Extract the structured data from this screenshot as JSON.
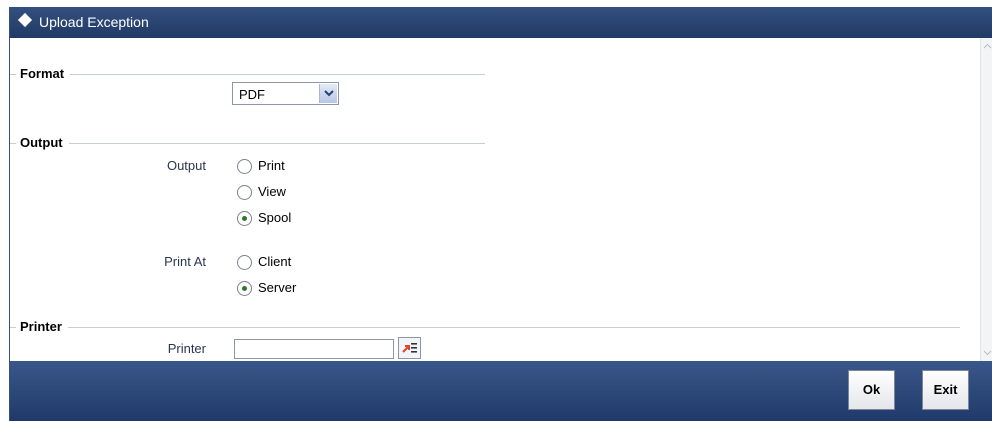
{
  "window": {
    "title": "Upload Exception"
  },
  "format": {
    "legend": "Format",
    "selected": "PDF"
  },
  "output": {
    "legend": "Output",
    "output_label": "Output",
    "output_options": [
      {
        "label": "Print",
        "checked": false
      },
      {
        "label": "View",
        "checked": false
      },
      {
        "label": "Spool",
        "checked": true
      }
    ],
    "print_at_label": "Print At",
    "print_at_options": [
      {
        "label": "Client",
        "checked": false
      },
      {
        "label": "Server",
        "checked": true
      }
    ]
  },
  "printer": {
    "legend": "Printer",
    "label": "Printer",
    "value": ""
  },
  "footer": {
    "ok_label": "Ok",
    "exit_label": "Exit"
  },
  "colors": {
    "titlebar": "#2a4474",
    "footer": "#2c4a7d",
    "radio_dot": "#2a7a2a"
  }
}
